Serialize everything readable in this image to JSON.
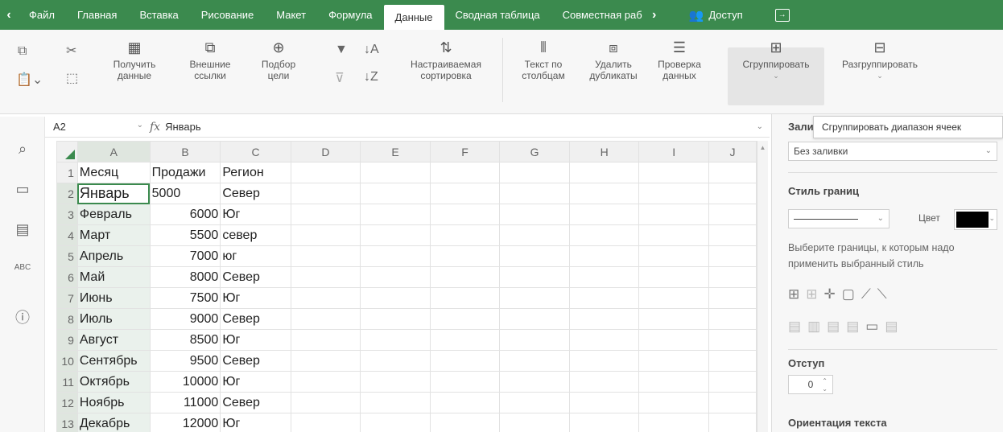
{
  "topbar": {
    "tabs": [
      {
        "label": "Файл"
      },
      {
        "label": "Главная"
      },
      {
        "label": "Вставка"
      },
      {
        "label": "Рисование"
      },
      {
        "label": "Макет"
      },
      {
        "label": "Формула"
      },
      {
        "label": "Данные",
        "active": true
      },
      {
        "label": "Сводная таблица"
      },
      {
        "label": "Совместная раб"
      }
    ],
    "access_label": "Доступ"
  },
  "ribbon": {
    "get_data": "Получить данные",
    "external_links": "Внешние ссылки",
    "goal_seek": "Подбор цели",
    "custom_sort": "Настраиваемая сортировка",
    "text_to_columns": "Текст по столбцам",
    "remove_duplicates": "Удалить дубликаты",
    "data_validation": "Проверка данных",
    "group": "Сгруппировать",
    "ungroup": "Разгруппировать"
  },
  "formula_bar": {
    "cell_ref": "A2",
    "fx": "fx",
    "value": "Январь"
  },
  "grid": {
    "columns": [
      "A",
      "B",
      "C",
      "D",
      "E",
      "F",
      "G",
      "H",
      "I",
      "J"
    ],
    "rows": [
      {
        "n": "1",
        "a": "Месяц",
        "b": "Продажи",
        "c": "Регион"
      },
      {
        "n": "2",
        "a": "Январь",
        "b": "5000",
        "c": "Север"
      },
      {
        "n": "3",
        "a": "Февраль",
        "b": "6000",
        "c": "Юг"
      },
      {
        "n": "4",
        "a": "Март",
        "b": "5500",
        "c": "север"
      },
      {
        "n": "5",
        "a": "Апрель",
        "b": "7000",
        "c": "юг"
      },
      {
        "n": "6",
        "a": "Май",
        "b": "8000",
        "c": "Север"
      },
      {
        "n": "7",
        "a": "Июнь",
        "b": "7500",
        "c": "Юг"
      },
      {
        "n": "8",
        "a": "Июль",
        "b": "9000",
        "c": "Север"
      },
      {
        "n": "9",
        "a": "Август",
        "b": "8500",
        "c": "Юг"
      },
      {
        "n": "10",
        "a": "Сентябрь",
        "b": "9500",
        "c": "Север"
      },
      {
        "n": "11",
        "a": "Октябрь",
        "b": "10000",
        "c": "Юг"
      },
      {
        "n": "12",
        "a": "Ноябрь",
        "b": "11000",
        "c": "Север"
      },
      {
        "n": "13",
        "a": "Декабрь",
        "b": "12000",
        "c": "Юг"
      }
    ]
  },
  "panel": {
    "fill_label": "Зали",
    "fill_value": "Без заливки",
    "border_style_label": "Стиль границ",
    "color_label": "Цвет",
    "color_value": "#000000",
    "hint": "Выберите границы, к которым надо применить выбранный стиль",
    "indent_label": "Отступ",
    "indent_value": "0",
    "orientation_label": "Ориентация текста"
  },
  "tooltip": "Сгруппировать диапазон ячеек"
}
